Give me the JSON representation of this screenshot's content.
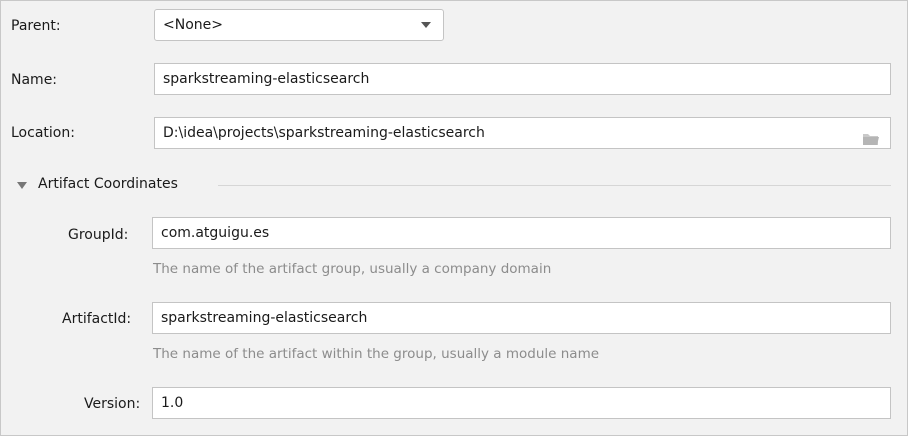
{
  "parent": {
    "label": "Parent:",
    "value": "<None>"
  },
  "name": {
    "label": "Name:",
    "value": "sparkstreaming-elasticsearch"
  },
  "location": {
    "label": "Location:",
    "value": "D:\\idea\\projects\\sparkstreaming-elasticsearch",
    "browse_icon": "folder-icon"
  },
  "artifact_section": {
    "title": "Artifact Coordinates",
    "group_id": {
      "label": "GroupId:",
      "value": "com.atguigu.es",
      "hint": "The name of the artifact group, usually a company domain"
    },
    "artifact_id": {
      "label": "ArtifactId:",
      "value": "sparkstreaming-elasticsearch",
      "hint": "The name of the artifact within the group, usually a module name"
    },
    "version": {
      "label": "Version:",
      "value": "1.0"
    }
  }
}
